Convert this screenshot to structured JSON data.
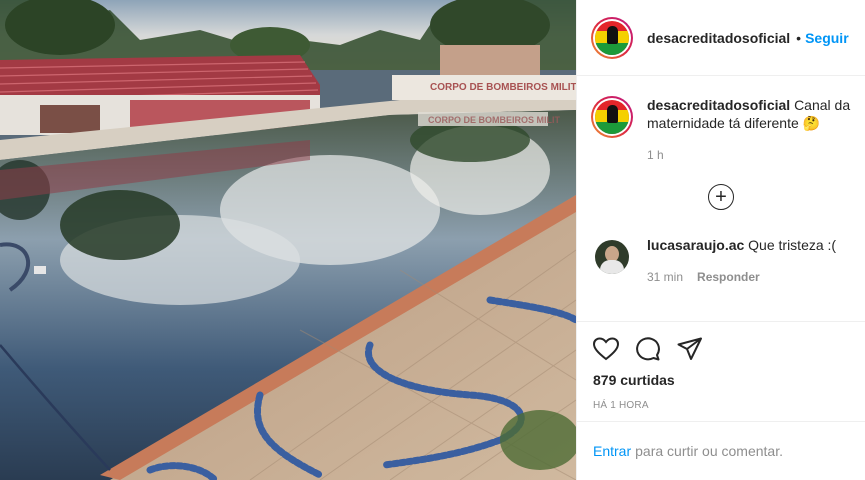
{
  "post": {
    "username": "desacreditadosoficial",
    "follow_label": "Seguir",
    "caption": "Canal da maternidade tá diferente 🤔",
    "caption_time": "1 h",
    "likes": "879 curtidas",
    "posted": "HÁ 1 HORA"
  },
  "photo": {
    "sign_text": "CORPO DE BOMBEIROS MILIT",
    "sign_reflection": "CORPO DE BOMBEIROS MILIT"
  },
  "comments": [
    {
      "username": "lucasaraujo.ac",
      "text": "Que tristeza :(",
      "time": "31 min",
      "reply_label": "Responder"
    }
  ],
  "more_comments_icon": "plus-circle-icon",
  "footer": {
    "login_link": "Entrar",
    "login_text": "para curtir ou comentar."
  },
  "icons": {
    "like": "heart-icon",
    "comment": "comment-icon",
    "share": "send-icon"
  },
  "colors": {
    "link_blue": "#0095f6",
    "secondary_text": "#8e8e8e",
    "border": "#efefef"
  }
}
